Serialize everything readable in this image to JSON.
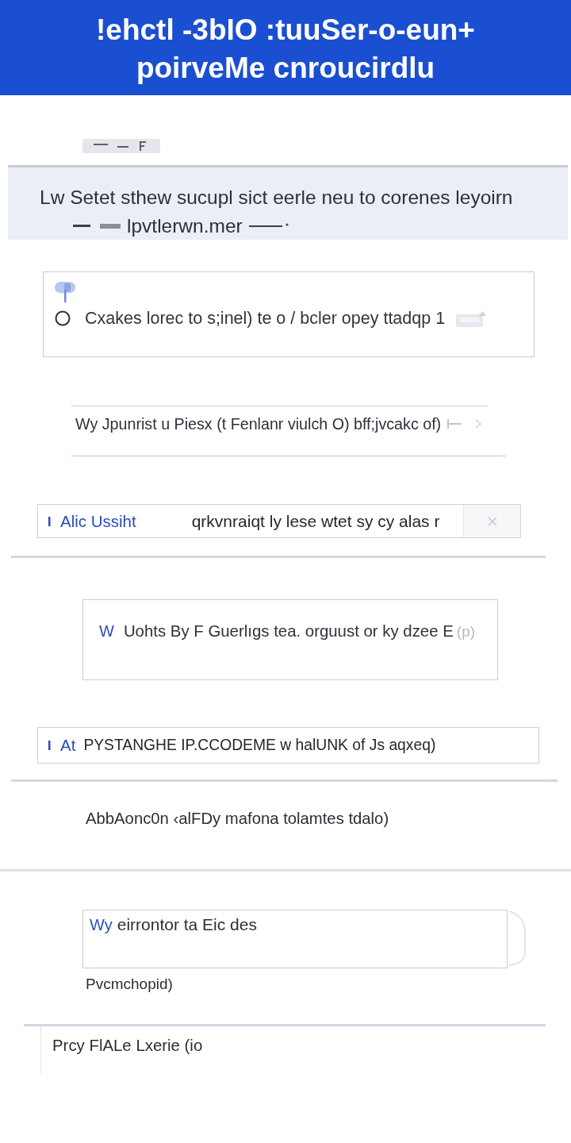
{
  "header": {
    "lines": [
      "!ehctl -3bIO :tuuSer-o-eun+",
      "poirveMe cnroucirdlu"
    ]
  },
  "notice": {
    "lines": [
      "Lw Setet sthew sucupl sict eerle neu to corenes leyoirn",
      "lpvtlerwn.mer"
    ]
  },
  "option": {
    "label": "Cxakes lorec to s;inel) te o / bcler opey ttadqp 1",
    "selected": false
  },
  "link_row": {
    "text": "Wy Jpunrist u Piesx (t Fenlanr viulch O) bff;jvcakc of)"
  },
  "field_1": {
    "label": "Alic Ussiht",
    "value": "qrkvnraiqt ly lese wtet sy cy alas r"
  },
  "card": {
    "prefix": "W",
    "text": "Uohts By F Guerlıgs tea. orguust or ky dzee E",
    "suffix": "(p)"
  },
  "field_2": {
    "label": "At",
    "value": "PYSTANGHE IP.CCODEME w halUNK of Js aqxeq)"
  },
  "paragraph": "AbbAonc0n ‹alFDy mafona tolamtes tdalo)",
  "text_area": {
    "prefix": "Wy",
    "value": "eirrontor ta Eic des"
  },
  "caption": "Pvcmchopid)",
  "footer": {
    "text": "Prcy FlALe Lxerie (io"
  }
}
